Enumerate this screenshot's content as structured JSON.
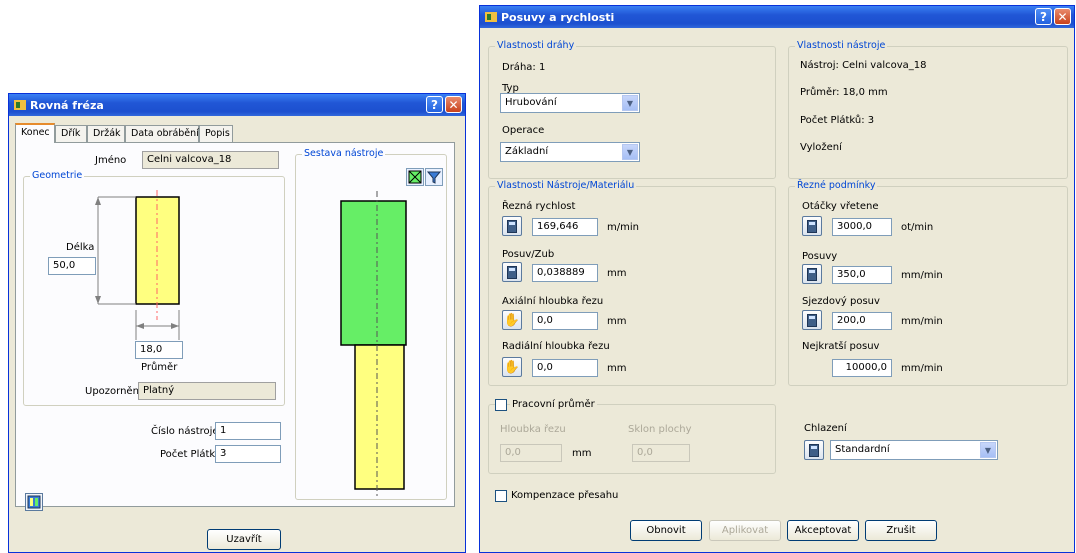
{
  "left": {
    "title": "Rovná fréza",
    "tabs": [
      "Konec",
      "Dřík",
      "Držák",
      "Data obrábění",
      "Popis"
    ],
    "name_label": "Jméno",
    "name_value": "Celni valcova_18",
    "geometry_label": "Geometrie",
    "length_label": "Délka",
    "length_value": "50,0",
    "diameter_value": "18,0",
    "diameter_label": "Průměr",
    "warning_label": "Upozornění",
    "warning_value": "Platný",
    "tool_number_label": "Číslo nástroje",
    "tool_number_value": "1",
    "flutes_label": "Počet Plátků",
    "flutes_value": "3",
    "assembly_label": "Sestava nástroje",
    "close_button": "Uzavřít",
    "colors": {
      "tool_yellow": "#ffff80",
      "holder_green": "#66ee66"
    }
  },
  "right": {
    "title": "Posuvy a rychlosti",
    "path_props": {
      "label": "Vlastnosti dráhy",
      "path_text": "Dráha: 1",
      "type_label": "Typ",
      "type_value": "Hrubování",
      "operation_label": "Operace",
      "operation_value": "Základní"
    },
    "tool_props": {
      "label": "Vlastnosti nástroje",
      "tool_text": "Nástroj: Celni valcova_18",
      "diameter_text": "Průměr: 18,0 mm",
      "flutes_text": "Počet Plátků: 3",
      "overhang_text": "Vyložení"
    },
    "material_props": {
      "label": "Vlastnosti Nástroje/Materiálu",
      "cutting_speed_label": "Řezná rychlost",
      "cutting_speed_value": "169,646",
      "cutting_speed_unit": "m/min",
      "feed_tooth_label": "Posuv/Zub",
      "feed_tooth_value": "0,038889",
      "feed_tooth_unit": "mm",
      "axial_label": "Axiální hloubka řezu",
      "axial_value": "0,0",
      "axial_unit": "mm",
      "radial_label": "Radiální hloubka řezu",
      "radial_value": "0,0",
      "radial_unit": "mm"
    },
    "cutting_conditions": {
      "label": "Řezné podmínky",
      "spindle_label": "Otáčky vřetene",
      "spindle_value": "3000,0",
      "spindle_unit": "ot/min",
      "feed_label": "Posuvy",
      "feed_value": "350,0",
      "feed_unit": "mm/min",
      "plunge_label": "Sjezdový posuv",
      "plunge_value": "200,0",
      "plunge_unit": "mm/min",
      "rapid_label": "Nejkratší posuv",
      "rapid_value": "10000,0",
      "rapid_unit": "mm/min"
    },
    "working_diameter": {
      "label": "Pracovní průměr",
      "depth_label": "Hloubka řezu",
      "depth_value": "0,0",
      "depth_unit": "mm",
      "slope_label": "Sklon plochy",
      "slope_value": "0,0"
    },
    "coolant_label": "Chlazení",
    "coolant_value": "Standardní",
    "compensation_label": "Kompenzace přesahu",
    "buttons": {
      "refresh": "Obnovit",
      "apply": "Aplikovat",
      "accept": "Akceptovat",
      "cancel": "Zrušit"
    }
  }
}
